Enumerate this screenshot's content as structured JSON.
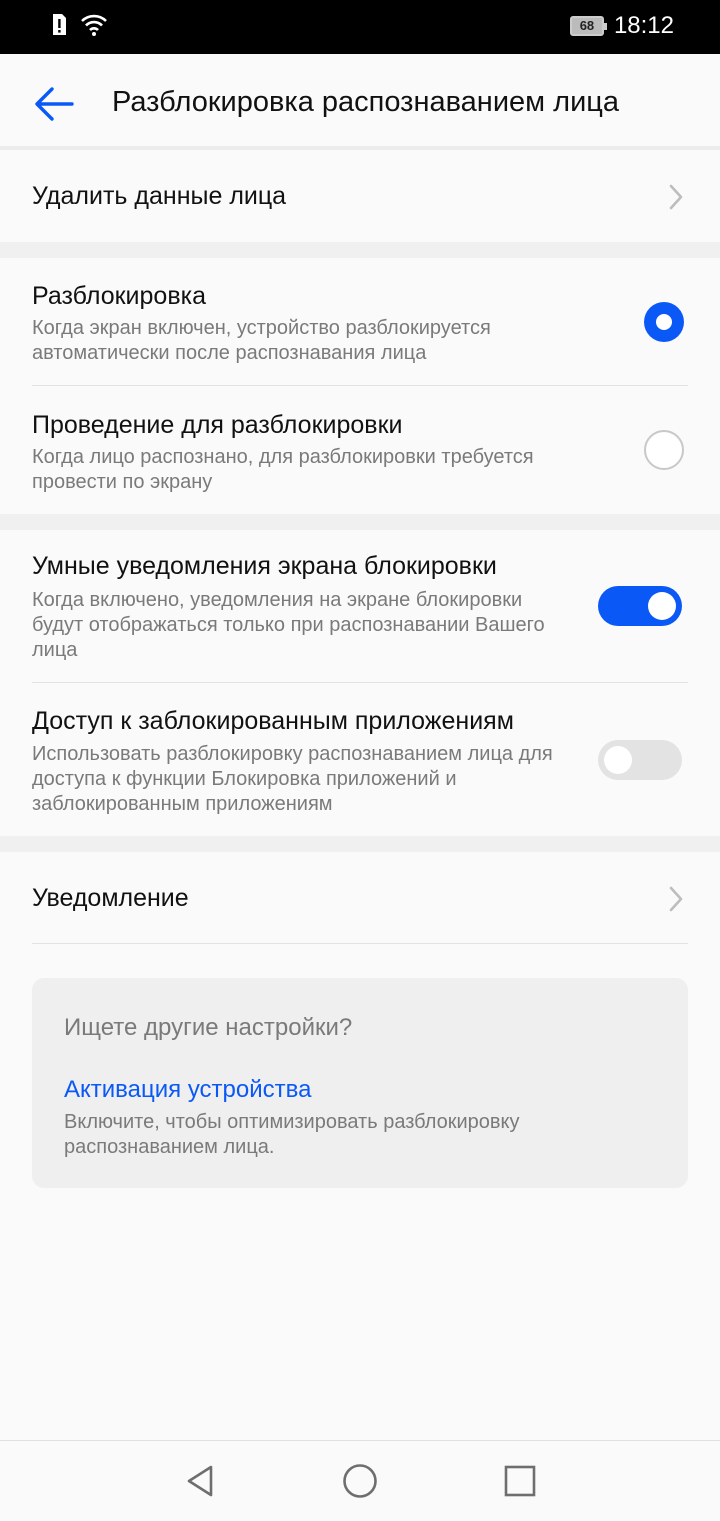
{
  "status_bar": {
    "time": "18:12",
    "battery_level": "68",
    "icons": [
      "alert-sim-icon",
      "wifi-icon"
    ]
  },
  "header": {
    "back_icon": "arrow-left-icon",
    "title": "Разблокировка распознаванием лица"
  },
  "items": {
    "delete_face": {
      "label": "Удалить данные лица"
    },
    "unlock": {
      "title": "Разблокировка",
      "subtitle": "Когда экран включен, устройство разблокируется автоматически после распознавания лица",
      "selected": true
    },
    "swipe_unlock": {
      "title": "Проведение для разблокировки",
      "subtitle": "Когда лицо распознано, для разблокировки требуется провести по экрану",
      "selected": false
    },
    "smart_notifications": {
      "title": "Умные уведомления экрана блокировки",
      "subtitle": "Когда включено, уведомления на экране блокировки будут отображаться только при распознавании Вашего лица",
      "enabled": true
    },
    "locked_apps": {
      "title": "Доступ к заблокированным приложениям",
      "subtitle": "Использовать разблокировку распознаванием лица для доступа к функции Блокировка приложений и заблокированным приложениям",
      "enabled": false
    },
    "notification": {
      "label": "Уведомление"
    }
  },
  "suggestions": {
    "question": "Ищете другие настройки?",
    "link": "Активация устройства",
    "description": "Включите, чтобы оптимизировать разблокировку распознаванием лица."
  },
  "nav_bar": {
    "icons": [
      "back-triangle-icon",
      "home-circle-icon",
      "recents-square-icon"
    ]
  },
  "colors": {
    "accent": "#0a59f7",
    "secondary_text": "#7a7a7a",
    "background": "#fafafa"
  }
}
